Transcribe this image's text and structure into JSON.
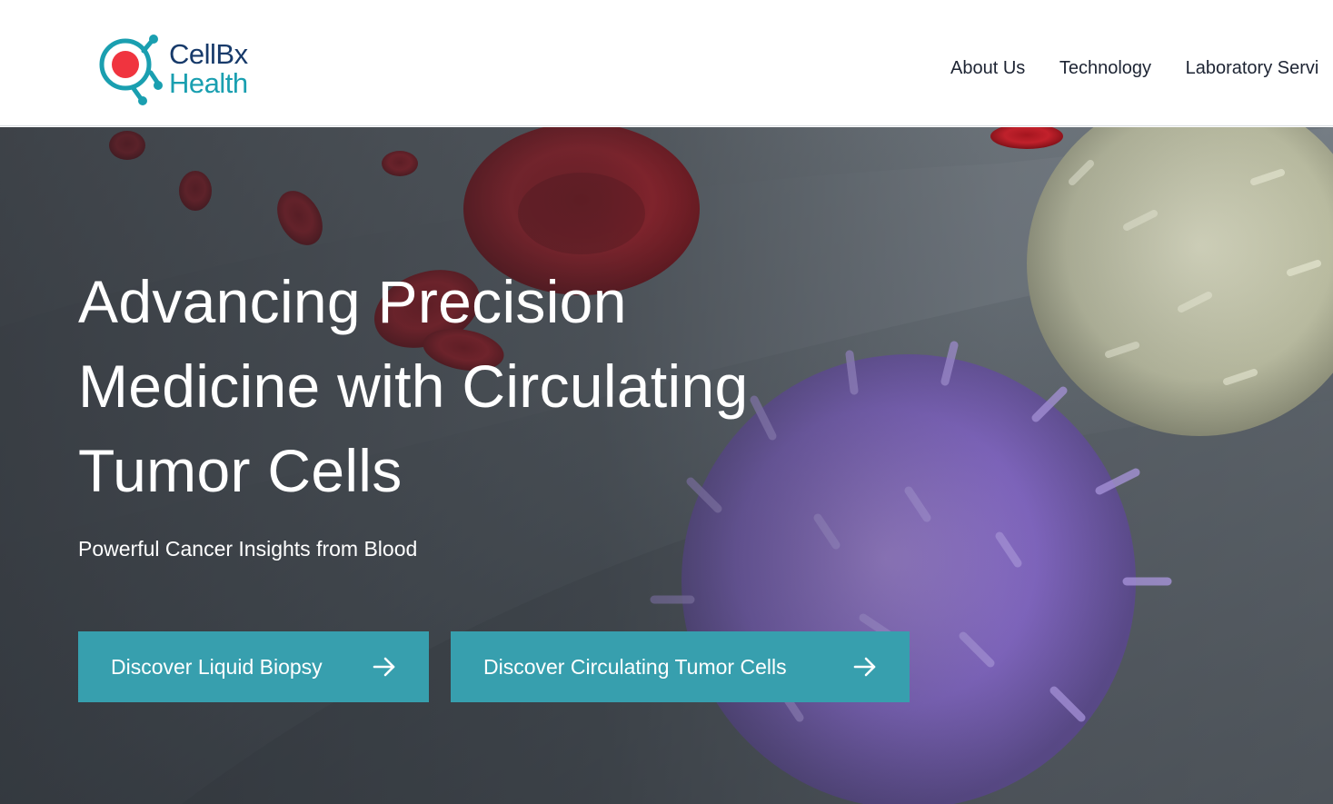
{
  "header": {
    "logo": {
      "line1": "CellBx",
      "line2": "Health"
    },
    "nav": [
      {
        "label": "About Us"
      },
      {
        "label": "Technology"
      },
      {
        "label": "Laboratory Servi"
      }
    ]
  },
  "hero": {
    "title_lines": [
      "Advancing Precision",
      "Medicine with Circulating",
      "Tumor Cells"
    ],
    "subtitle": "Powerful Cancer Insights from Blood",
    "buttons": [
      {
        "label": "Discover Liquid Biopsy",
        "icon": "arrow-right-icon"
      },
      {
        "label": "Discover Circulating Tumor Cells",
        "icon": "arrow-right-icon"
      }
    ],
    "background_image": "red blood cells, white blood cell and purple tumor cell in a blood vessel"
  },
  "colors": {
    "brand_navy": "#173a6a",
    "brand_teal": "#1a9fb0",
    "logo_red": "#f0343f",
    "button_teal": "#379fae",
    "nav_text": "#1d2433"
  }
}
